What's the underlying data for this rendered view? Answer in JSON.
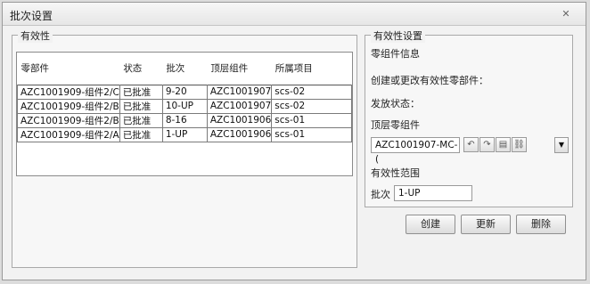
{
  "window": {
    "title": "批次设置",
    "close_label": "✕"
  },
  "effectivity": {
    "group_title": "有效性",
    "columns": [
      "零部件",
      "状态",
      "批次",
      "顶层组件",
      "所属项目"
    ],
    "rows": [
      [
        "AZC1001909-组件2/C",
        "已批准",
        "9-20",
        "AZC1001907",
        "scs-02"
      ],
      [
        "AZC1001909-组件2/B",
        "已批准",
        "10-UP",
        "AZC1001907",
        "scs-02"
      ],
      [
        "AZC1001909-组件2/B",
        "已批准",
        "8-16",
        "AZC1001906",
        "scs-01"
      ],
      [
        "AZC1001909-组件2/A",
        "已批准",
        "1-UP",
        "AZC1001906",
        "scs-01"
      ]
    ]
  },
  "settings": {
    "group_title": "有效性设置",
    "part_info_label": "零组件信息",
    "create_or_change_label": "创建或更改有效性零部件：",
    "release_status_label": "发放状态：",
    "top_part_label": "顶层零组件",
    "top_part_value": "AZC1001907-MC-(",
    "scope_label": "有效性范围",
    "batch_label": "批次",
    "batch_value": "1-UP"
  },
  "buttons": {
    "create": "创建",
    "update": "更新",
    "delete": "删除"
  }
}
